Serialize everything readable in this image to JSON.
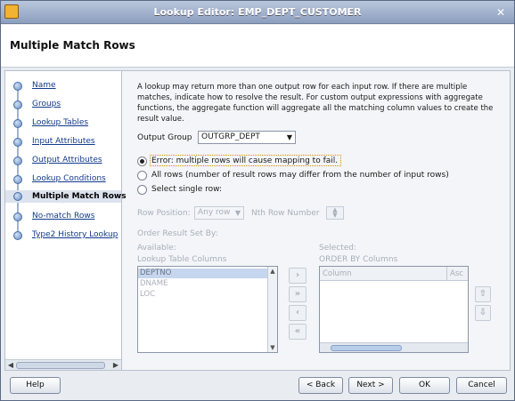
{
  "window": {
    "title": "Lookup Editor: EMP_DEPT_CUSTOMER",
    "close_symbol": "✕"
  },
  "header": {
    "title": "Multiple Match Rows"
  },
  "sidebar": {
    "items": [
      {
        "label": "Name",
        "state": "link"
      },
      {
        "label": "Groups",
        "state": "link"
      },
      {
        "label": "Lookup Tables",
        "state": "link"
      },
      {
        "label": "Input Attributes",
        "state": "link"
      },
      {
        "label": "Output Attributes",
        "state": "link"
      },
      {
        "label": "Lookup Conditions",
        "state": "link"
      },
      {
        "label": "Multiple Match Rows",
        "state": "current"
      },
      {
        "label": "No-match Rows",
        "state": "link"
      },
      {
        "label": "Type2 History Lookup",
        "state": "link"
      }
    ]
  },
  "main": {
    "description": "A lookup may return more than one output row for each input row.  If there are multiple matches, indicate how to resolve the result.  For custom output expressions with aggregate functions, the aggregate function will aggregate all the matching column values to create the result value.",
    "output_group_label": "Output Group",
    "output_group_value": "OUTGRP_DEPT",
    "radios": [
      {
        "label": "Error: multiple rows will cause mapping to fail.",
        "selected": true
      },
      {
        "label": "All rows (number of result rows may differ from the number of input rows)",
        "selected": false
      },
      {
        "label": "Select single row:",
        "selected": false
      }
    ],
    "row_position_label": "Row Position:",
    "row_position_value": "Any row",
    "nth_row_label": "Nth Row Number",
    "order_result_label": "Order Result Set By:",
    "available_label": "Available:",
    "lookup_columns_label": "Lookup Table Columns",
    "available_columns": [
      "DEPTNO",
      "DNAME",
      "LOC"
    ],
    "selected_label": "Selected:",
    "order_by_label": "ORDER BY Columns",
    "order_headers": [
      "Column",
      "Asc"
    ]
  },
  "footer": {
    "help": "Help",
    "back": "< Back",
    "next": "Next >",
    "ok": "OK",
    "cancel": "Cancel"
  }
}
